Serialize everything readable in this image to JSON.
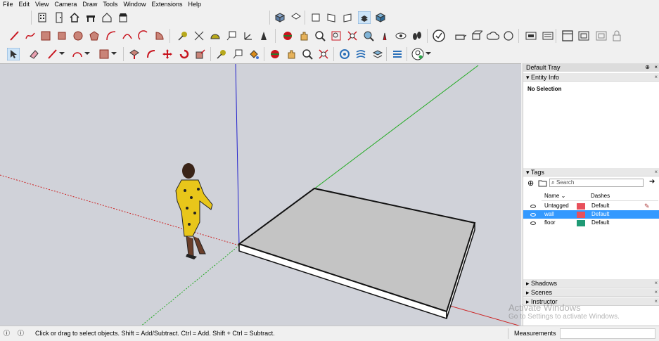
{
  "menu": [
    "File",
    "Edit",
    "View",
    "Camera",
    "Draw",
    "Tools",
    "Window",
    "Extensions",
    "Help"
  ],
  "colors": {
    "viewport_bg": "#d0d2d9",
    "axis_red": "#cc2222",
    "axis_green": "#22aa22",
    "axis_blue": "#2222cc",
    "selection": "#3399ff",
    "untagged_swatch": "#e8505b",
    "wall_swatch": "#e8505b",
    "floor_swatch": "#1f9a75",
    "dress": "#e8c61a"
  },
  "toolbar_row1": [
    "building-icon",
    "door-icon",
    "home-icon",
    "bench-icon",
    "house-outline-icon",
    "shop-icon"
  ],
  "toolbar_views": [
    "iso-view-icon",
    "top-view-icon",
    "front-view-icon",
    "right-view-icon",
    "back-view-icon",
    "left-view-icon",
    "style-xray-icon",
    "style-shaded-icon"
  ],
  "tray": {
    "title": "Default Tray",
    "entity_info": {
      "header": "Entity Info",
      "selection_text": "No Selection"
    },
    "tags": {
      "header": "Tags",
      "search_placeholder": "Search",
      "col_name": "Name",
      "col_dashes": "Dashes",
      "rows": [
        {
          "name": "Untagged",
          "dashes": "Default"
        },
        {
          "name": "wall",
          "dashes": "Default"
        },
        {
          "name": "floor",
          "dashes": "Default"
        }
      ]
    },
    "panels": [
      "Shadows",
      "Scenes",
      "Instructor"
    ]
  },
  "watermark": {
    "line1": "Activate Windows",
    "line2": "Go to Settings to activate Windows."
  },
  "status": {
    "message": "Click or drag to select objects. Shift = Add/Subtract. Ctrl = Add. Shift + Ctrl = Subtract.",
    "measurements_label": "Measurements"
  }
}
